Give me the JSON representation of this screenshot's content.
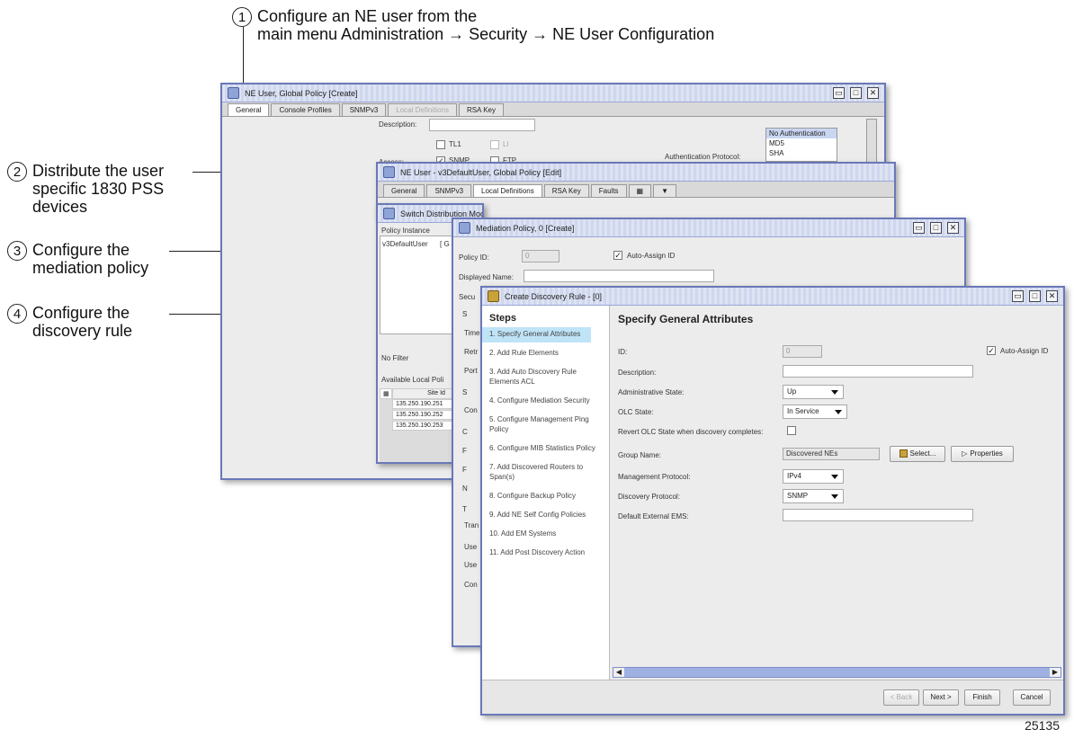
{
  "annotations": {
    "step1": {
      "num": "1",
      "line1": "Configure an NE user from the",
      "line2": "main menu Administration → Security → NE User Configuration"
    },
    "step2": {
      "num": "2",
      "line1": "Distribute the user",
      "line2": "specific 1830 PSS",
      "line3": "devices"
    },
    "step3": {
      "num": "3",
      "line1": "Configure the",
      "line2": "mediation policy"
    },
    "step4": {
      "num": "4",
      "line1": "Configure the",
      "line2": "discovery rule"
    },
    "figure_number": "25135"
  },
  "win1": {
    "title": "NE User, Global Policy [Create]",
    "tabs": [
      "General",
      "Console Profiles",
      "SNMPv3",
      "Local Definitions",
      "RSA Key"
    ],
    "description_label": "Description:",
    "access_label": "Access:",
    "access_options": [
      "TL1",
      "LI",
      "SNMP",
      "FTP"
    ],
    "auth_protocol_label": "Authentication Protocol:",
    "auth_protocols": [
      "No Authentication",
      "MD5",
      "SHA"
    ]
  },
  "win2": {
    "title": "NE User - v3DefaultUser, Global Policy [Edit]",
    "tabs": [
      "General",
      "SNMPv3",
      "Local Definitions",
      "RSA Key",
      "Faults"
    ]
  },
  "win3": {
    "title": "Switch Distribution Mode - NE User Configuration v3DefaultUser ID 0",
    "policy_instance_label": "Policy Instance",
    "policy_instance_value": "v3DefaultUser",
    "policy_instance_suffix": "[ G",
    "filter_label": "No Filter",
    "available_label": "Available Local Poli",
    "site_id_header": "Site Id",
    "site_ids": [
      "135.250.190.251",
      "135.250.190.252",
      "135.250.190.253"
    ]
  },
  "win4": {
    "title": "Mediation Policy, 0 [Create]",
    "policy_id_label": "Policy ID:",
    "policy_id_value": "0",
    "auto_assign_label": "Auto-Assign ID",
    "displayed_name_label": "Displayed Name:",
    "partial_labels": [
      "Secu",
      "S",
      "Time",
      "Retr",
      "Port",
      "S",
      "Con",
      "C",
      "F",
      "F",
      "N",
      "T",
      "Tran",
      "Use",
      "Use",
      "Con"
    ]
  },
  "win5": {
    "title": "Create Discovery Rule - [0]",
    "steps_title": "Steps",
    "steps": [
      "1. Specify General Attributes",
      "2. Add Rule Elements",
      "3. Add Auto Discovery Rule Elements ACL",
      "4. Configure Mediation Security",
      "5. Configure Management Ping Policy",
      "6. Configure MIB Statistics Policy",
      "7. Add Discovered Routers to Span(s)",
      "8. Configure Backup Policy",
      "9. Add NE Self Config Policies",
      "10. Add EM Systems",
      "11. Add Post Discovery Action"
    ],
    "main_title": "Specify General Attributes",
    "id_label": "ID:",
    "id_value": "0",
    "auto_assign_label": "Auto-Assign ID",
    "description_label": "Description:",
    "admin_state_label": "Administrative State:",
    "admin_state_value": "Up",
    "olc_state_label": "OLC State:",
    "olc_state_value": "In Service",
    "revert_label": "Revert OLC State when discovery completes:",
    "group_name_label": "Group Name:",
    "group_name_value": "Discovered NEs",
    "select_label": "Select...",
    "properties_label": "Properties",
    "mgmt_protocol_label": "Management Protocol:",
    "mgmt_protocol_value": "IPv4",
    "discovery_protocol_label": "Discovery Protocol:",
    "discovery_protocol_value": "SNMP",
    "default_ems_label": "Default External EMS:",
    "back_label": "< Back",
    "next_label": "Next >",
    "finish_label": "Finish",
    "cancel_label": "Cancel"
  }
}
